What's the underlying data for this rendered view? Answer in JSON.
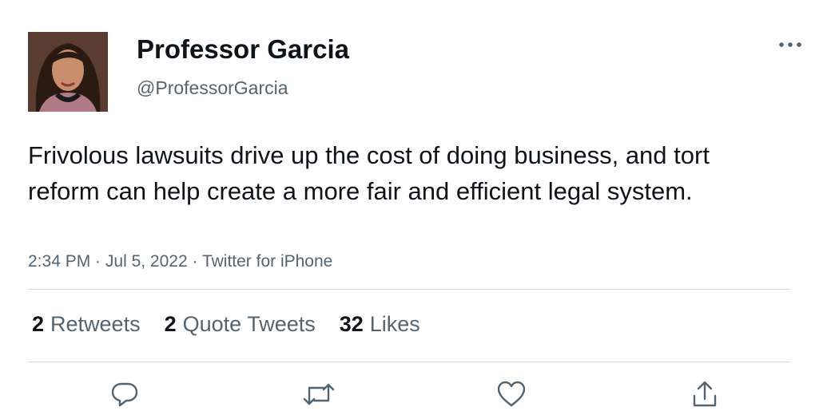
{
  "author": {
    "name": "Professor Garcia",
    "handle": "@ProfessorGarcia"
  },
  "tweet": {
    "text": "Frivolous lawsuits drive up the cost of doing business, and tort reform can help create a more fair and efficient legal system.",
    "time": "2:34 PM",
    "separator": " · ",
    "date": "Jul 5, 2022",
    "source": "Twitter for iPhone"
  },
  "stats": [
    {
      "count": "2",
      "label": "Retweets"
    },
    {
      "count": "2",
      "label": "Quote Tweets"
    },
    {
      "count": "32",
      "label": "Likes"
    }
  ],
  "actions": [
    {
      "icon": "reply-icon"
    },
    {
      "icon": "retweet-icon"
    },
    {
      "icon": "like-icon"
    },
    {
      "icon": "share-icon"
    }
  ],
  "colors": {
    "text_primary": "#0f1419",
    "text_secondary": "#536471",
    "divider": "#d9dde0"
  }
}
